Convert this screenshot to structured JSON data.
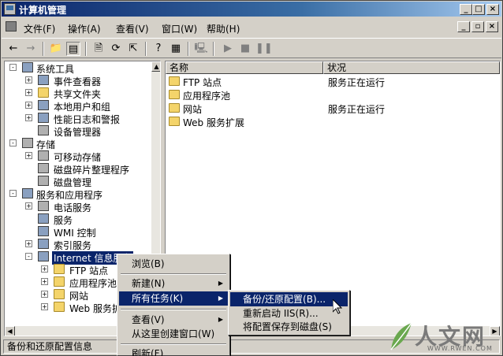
{
  "window": {
    "title": "计算机管理"
  },
  "menu": [
    "文件(F)",
    "操作(A)",
    "查看(V)",
    "窗口(W)",
    "帮助(H)"
  ],
  "tree": [
    {
      "label": "系统工具",
      "expander": "-"
    },
    {
      "label": "事件查看器",
      "expander": "+"
    },
    {
      "label": "共享文件夹",
      "expander": "+"
    },
    {
      "label": "本地用户和组",
      "expander": "+"
    },
    {
      "label": "性能日志和警报",
      "expander": "+"
    },
    {
      "label": "设备管理器",
      "expander": ""
    },
    {
      "label": "存储",
      "expander": "-"
    },
    {
      "label": "可移动存储",
      "expander": "+"
    },
    {
      "label": "磁盘碎片整理程序",
      "expander": ""
    },
    {
      "label": "磁盘管理",
      "expander": ""
    },
    {
      "label": "服务和应用程序",
      "expander": "-"
    },
    {
      "label": "电话服务",
      "expander": "+"
    },
    {
      "label": "服务",
      "expander": ""
    },
    {
      "label": "WMI 控制",
      "expander": ""
    },
    {
      "label": "索引服务",
      "expander": "+"
    },
    {
      "label": "Internet 信息服务",
      "expander": "-"
    },
    {
      "label": "FTP 站点",
      "expander": "+"
    },
    {
      "label": "应用程序池",
      "expander": "+"
    },
    {
      "label": "网站",
      "expander": "+"
    },
    {
      "label": "Web 服务扩",
      "expander": "+"
    }
  ],
  "list": {
    "columns": [
      "名称",
      "状况"
    ],
    "rows": [
      {
        "name": "FTP 站点",
        "status": "服务正在运行"
      },
      {
        "name": "应用程序池",
        "status": ""
      },
      {
        "name": "网站",
        "status": "服务正在运行"
      },
      {
        "name": "Web 服务扩展",
        "status": ""
      }
    ]
  },
  "context_menu": {
    "items": [
      {
        "label": "浏览(B)",
        "submenu": false
      },
      {
        "label": "新建(N)",
        "submenu": true
      },
      {
        "label": "所有任务(K)",
        "submenu": true,
        "highlighted": true
      },
      {
        "label": "查看(V)",
        "submenu": true
      },
      {
        "label": "从这里创建窗口(W)",
        "submenu": false
      },
      {
        "label": "刷新(F)",
        "submenu": false
      }
    ]
  },
  "submenu": {
    "items": [
      {
        "label": "备份/还原配置(B)...",
        "highlighted": true
      },
      {
        "label": "重新启动 IIS(R)...",
        "highlighted": false
      },
      {
        "label": "将配置保存到磁盘(S)",
        "highlighted": false
      }
    ]
  },
  "status": {
    "text": "备份和还原配置信息"
  },
  "watermark": {
    "text": "人文网",
    "url": "WWW.RWEN.COM"
  },
  "colors": {
    "selection": "#0a246a",
    "title_start": "#0a246a",
    "title_end": "#a6caf0"
  }
}
